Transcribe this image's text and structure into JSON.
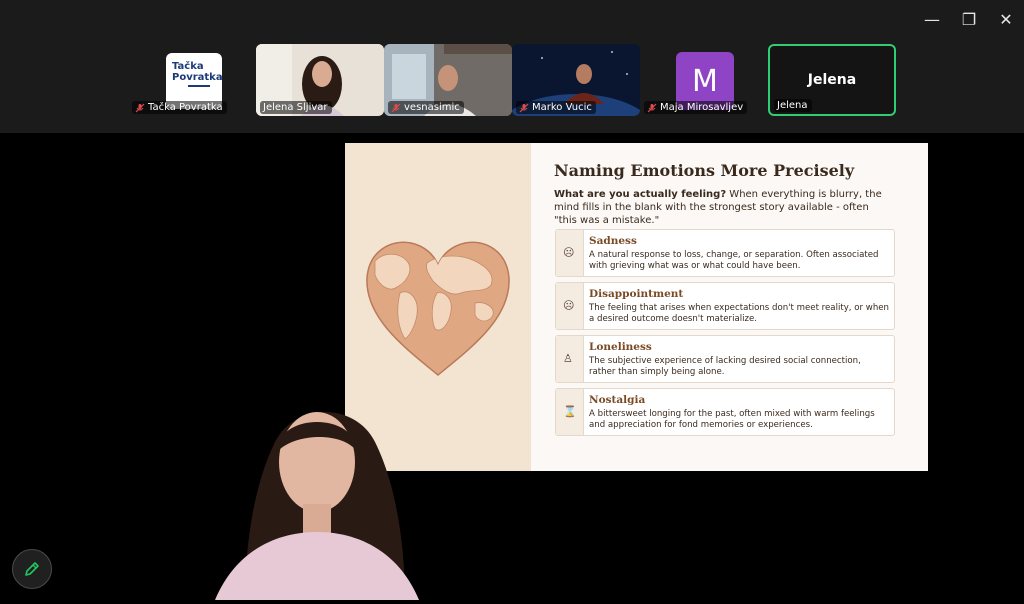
{
  "window": {
    "minimize_glyph": "—",
    "restore_glyph": "❐",
    "close_glyph": "✕"
  },
  "participants": [
    {
      "name": "Tačka Povratka",
      "muted": true
    },
    {
      "name": "Jelena Sljivar",
      "muted": false
    },
    {
      "name": "vesnasimic",
      "muted": true
    },
    {
      "name": "Marko Vucic",
      "muted": true
    },
    {
      "name": "Maja Mirosavljev",
      "muted": true
    },
    {
      "name": "Jelena",
      "muted": false
    }
  ],
  "logo": {
    "line1": "Tačka",
    "line2": "Povratka"
  },
  "avatar_initial": "M",
  "active_speaker_label": "Jelena",
  "slide": {
    "title": "Naming Emotions More Precisely",
    "intro_bold": "What are you actually feeling?",
    "intro_rest": " When everything is blurry, the mind fills in the blank with the strongest story available - often \"this was a mistake.\"",
    "cards": [
      {
        "icon": "sad-face-icon",
        "title": "Sadness",
        "desc": "A natural response to loss, change, or separation. Often associated with grieving what was or what could have been."
      },
      {
        "icon": "disappointed-face-icon",
        "title": "Disappointment",
        "desc": "The feeling that arises when expectations don't meet reality, or when a desired outcome doesn't materialize."
      },
      {
        "icon": "lone-person-icon",
        "title": "Loneliness",
        "desc": "The subjective experience of lacking desired social connection, rather than simply being alone."
      },
      {
        "icon": "hourglass-icon",
        "title": "Nostalgia",
        "desc": "A bittersweet longing for the past, often mixed with warm feelings and appreciation for fond memories or experiences."
      }
    ]
  },
  "colors": {
    "active_border": "#2fcd74",
    "avatar_bg": "#8e44c4",
    "slide_accent": "#7a4a25"
  }
}
